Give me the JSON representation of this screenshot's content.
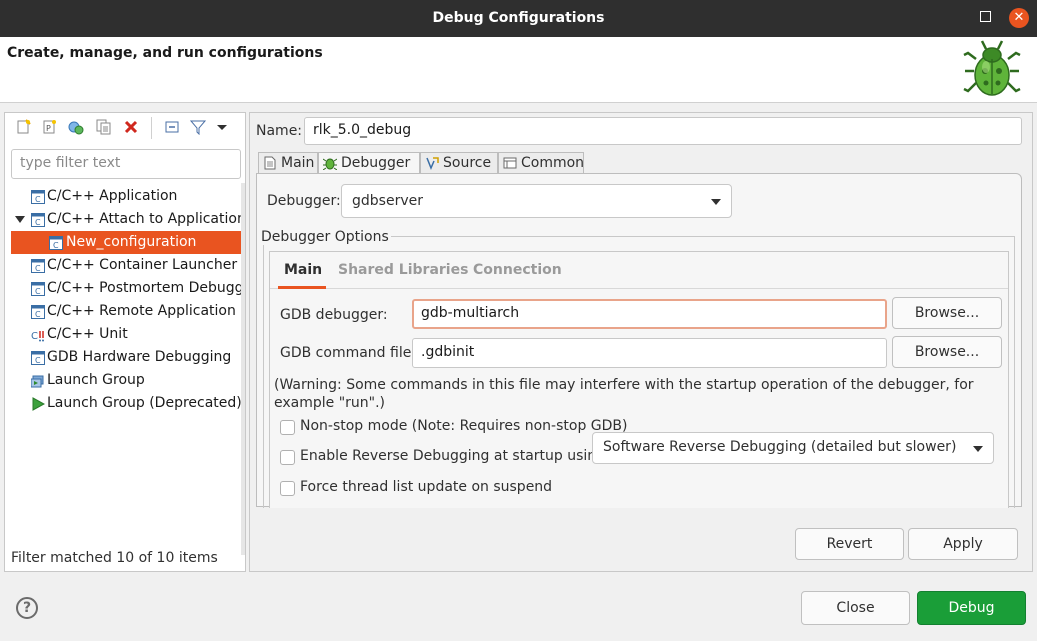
{
  "window": {
    "title": "Debug Configurations"
  },
  "header": {
    "heading": "Create, manage, and run configurations"
  },
  "sidebar": {
    "filter_placeholder": "type filter text",
    "toolbar_icons": [
      "new-config-icon",
      "new-prototype-icon",
      "export-icon",
      "duplicate-icon",
      "delete-icon",
      "collapse-all-icon",
      "filter-icon",
      "dropdown-menu-icon"
    ],
    "items": [
      {
        "label": "C/C++ Application",
        "icon": "c-app-icon"
      },
      {
        "label": "C/C++ Attach to Application",
        "icon": "c-app-icon",
        "expanded": true
      },
      {
        "label": "New_configuration",
        "icon": "c-app-icon",
        "selected": true
      },
      {
        "label": "C/C++ Container Launcher",
        "icon": "c-app-icon"
      },
      {
        "label": "C/C++ Postmortem Debugger",
        "icon": "c-app-icon"
      },
      {
        "label": "C/C++ Remote Application",
        "icon": "c-app-icon"
      },
      {
        "label": "C/C++ Unit",
        "icon": "c-unit-icon"
      },
      {
        "label": "GDB Hardware Debugging",
        "icon": "c-app-icon"
      },
      {
        "label": "Launch Group",
        "icon": "launch-group-icon"
      },
      {
        "label": "Launch Group (Deprecated)",
        "icon": "run-icon"
      }
    ],
    "filter_status": "Filter matched 10 of 10 items"
  },
  "main": {
    "name_label": "Name:",
    "name_value": "rlk_5.0_debug",
    "tabs": [
      {
        "label": "Main",
        "icon": "main-tab-icon"
      },
      {
        "label": "Debugger",
        "icon": "bug-icon",
        "active": true
      },
      {
        "label": "Source",
        "icon": "source-icon"
      },
      {
        "label": "Common",
        "icon": "common-icon"
      }
    ],
    "debugger_label": "Debugger:",
    "debugger_value": "gdbserver",
    "options_label": "Debugger Options",
    "inner_tabs": [
      {
        "label": "Main",
        "active": true
      },
      {
        "label": "Shared Libraries"
      },
      {
        "label": "Connection"
      }
    ],
    "gdb_debugger_label": "GDB debugger:",
    "gdb_debugger_value": "gdb-multiarch",
    "gdb_command_label": "GDB command file:",
    "gdb_command_value": ".gdbinit",
    "browse_label": "Browse...",
    "warning_text": "(Warning: Some commands in this file may interfere with the startup operation of the debugger, for example \"run\".)",
    "nonstop_label": "Non-stop mode (Note: Requires non-stop GDB)",
    "reverse_label": "Enable Reverse Debugging at startup using:",
    "reverse_value": "Software Reverse Debugging (detailed but slower)",
    "force_thread_label": "Force thread list update on suspend",
    "revert_label": "Revert",
    "apply_label": "Apply"
  },
  "footer": {
    "help_label": "?",
    "close_label": "Close",
    "debug_label": "Debug"
  },
  "colors": {
    "accent": "#e95420",
    "debug_button": "#1a9e38",
    "titlebar": "#2f2f2f"
  }
}
